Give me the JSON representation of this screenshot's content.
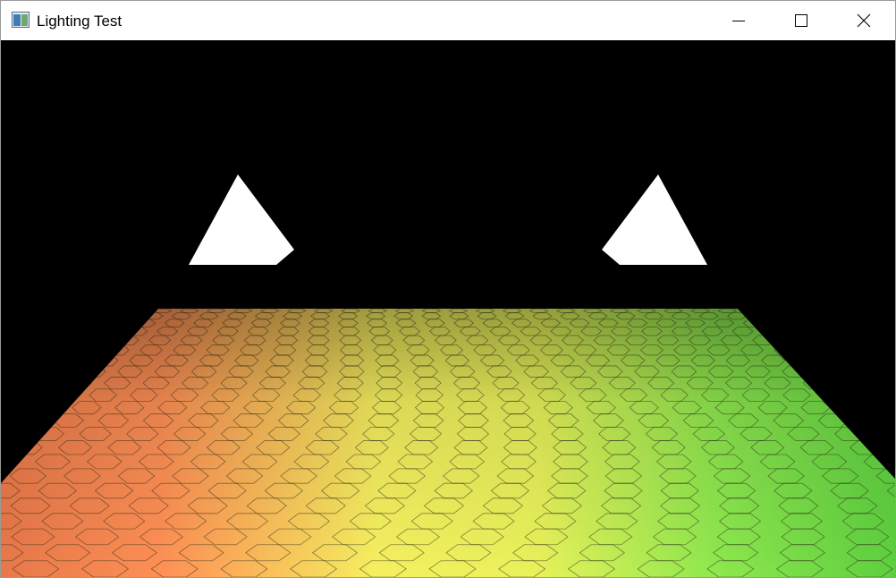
{
  "window": {
    "title": "Lighting Test"
  },
  "icons": {
    "app": "app-window-icon",
    "minimize": "minimize-icon",
    "maximize": "maximize-icon",
    "close": "close-icon"
  },
  "scene": {
    "background_color": "#000000",
    "light_marker_color": "#ffffff",
    "floor_colors": {
      "left": "#ff8a55",
      "center": "#f2f25a",
      "right": "#6ee84a"
    }
  }
}
